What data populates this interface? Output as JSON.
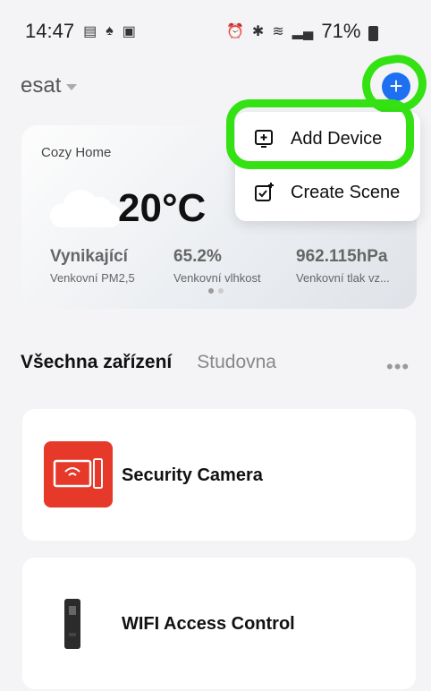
{
  "status_bar": {
    "time": "14:47",
    "battery": "71%"
  },
  "header": {
    "home_name": "esat"
  },
  "weather": {
    "home_label": "Cozy Home",
    "temperature": "20°C",
    "stats": [
      {
        "value": "Vynikající",
        "label": "Venkovní PM2,5"
      },
      {
        "value": "65.2%",
        "label": "Venkovní vlhkost"
      },
      {
        "value": "962.115hPa",
        "label": "Venkovní tlak vz..."
      }
    ]
  },
  "menu": {
    "items": [
      {
        "label": "Add Device",
        "icon": "add-device-icon"
      },
      {
        "label": "Create Scene",
        "icon": "create-scene-icon"
      }
    ]
  },
  "tabs": {
    "items": [
      "Všechna zařízení",
      "Studovna"
    ],
    "more": "•••"
  },
  "devices": [
    {
      "name": "Security Camera",
      "icon": "security-camera-icon"
    },
    {
      "name": "WIFI Access Control",
      "icon": "access-control-icon"
    }
  ],
  "colors": {
    "accent": "#1e6ff1",
    "highlight": "#34e214",
    "camera_red": "#e6392a"
  }
}
